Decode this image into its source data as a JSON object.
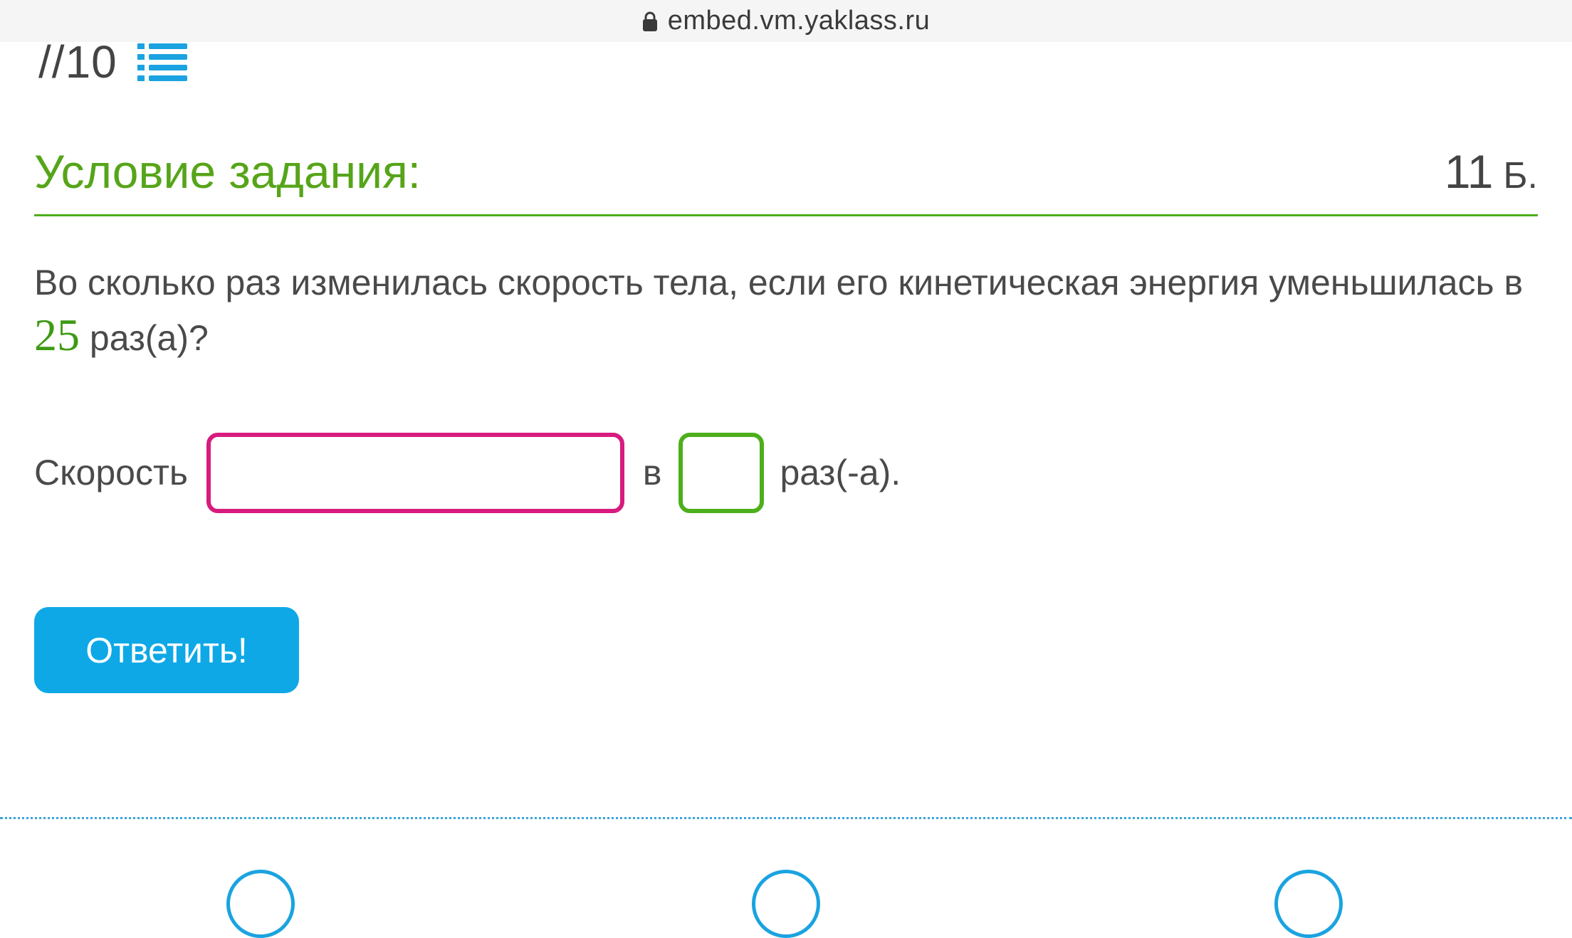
{
  "browser": {
    "url": "embed.vm.yaklass.ru"
  },
  "progress": {
    "text": "//10"
  },
  "task": {
    "title": "Условие задания:",
    "score_value": "11",
    "score_unit": "Б."
  },
  "question": {
    "text_before": " Во сколько раз изменилась скорость тела, если его кинетическая энергия уменьшилась в ",
    "number": "25",
    "text_after": " раз(а)?"
  },
  "answer": {
    "prefix": "Скорость",
    "middle": "в",
    "suffix": "раз(-а).",
    "input_a_value": "",
    "input_b_value": ""
  },
  "submit": {
    "label": "Ответить!"
  },
  "colors": {
    "accent_green": "#56a519",
    "accent_blue": "#0fa8e6",
    "input_magenta": "#d81b7e"
  },
  "icons": {
    "lock": "lock-icon",
    "list": "list-icon"
  }
}
